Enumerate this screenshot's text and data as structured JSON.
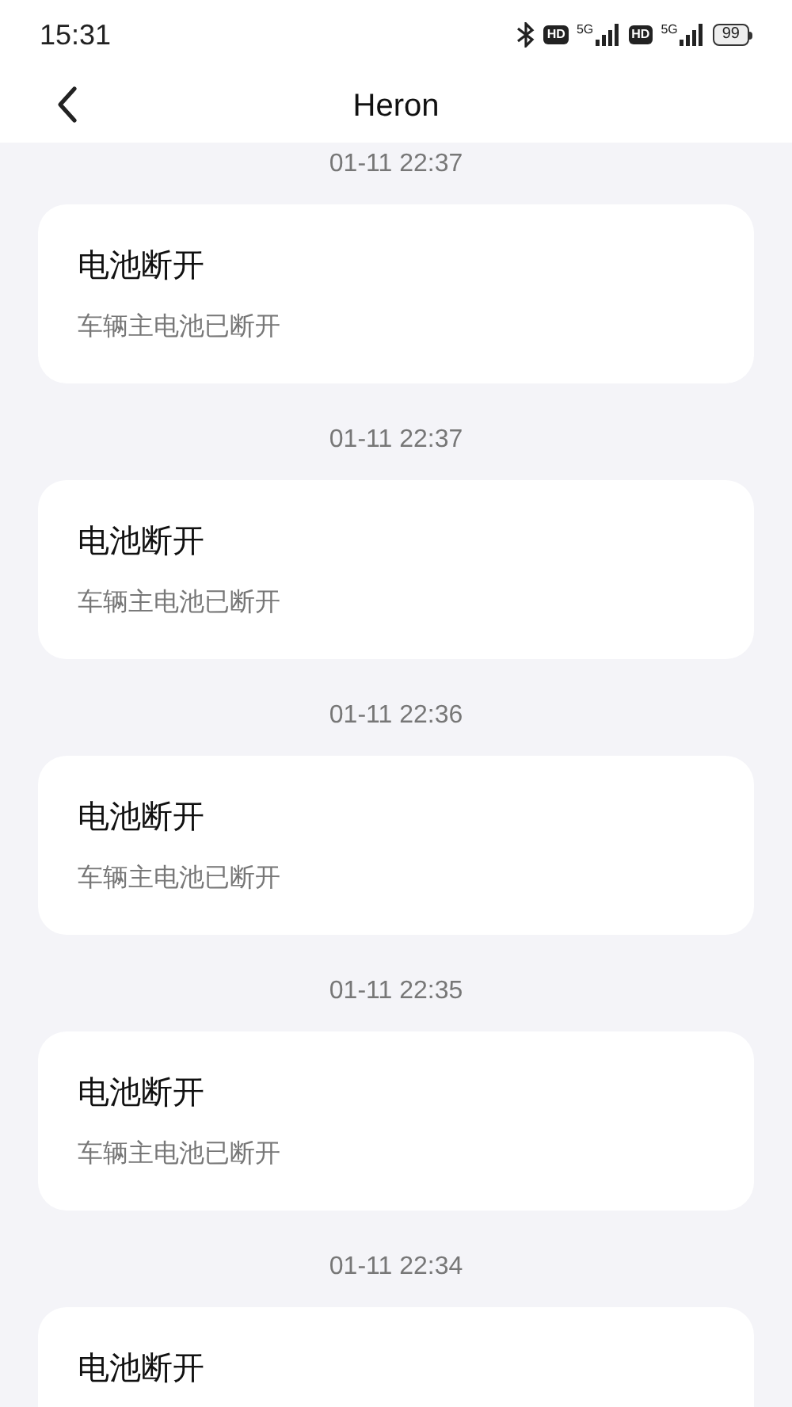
{
  "status_bar": {
    "time": "15:31",
    "badges": [
      {
        "hd": "HD",
        "net": "5G"
      },
      {
        "hd": "HD",
        "net": "5G"
      }
    ],
    "battery": "99"
  },
  "header": {
    "title": "Heron"
  },
  "messages": [
    {
      "time": "01-11 22:37",
      "title": "电池断开",
      "body": "车辆主电池已断开"
    },
    {
      "time": "01-11 22:37",
      "title": "电池断开",
      "body": "车辆主电池已断开"
    },
    {
      "time": "01-11 22:36",
      "title": "电池断开",
      "body": "车辆主电池已断开"
    },
    {
      "time": "01-11 22:35",
      "title": "电池断开",
      "body": "车辆主电池已断开"
    },
    {
      "time": "01-11 22:34",
      "title": "电池断开"
    }
  ]
}
